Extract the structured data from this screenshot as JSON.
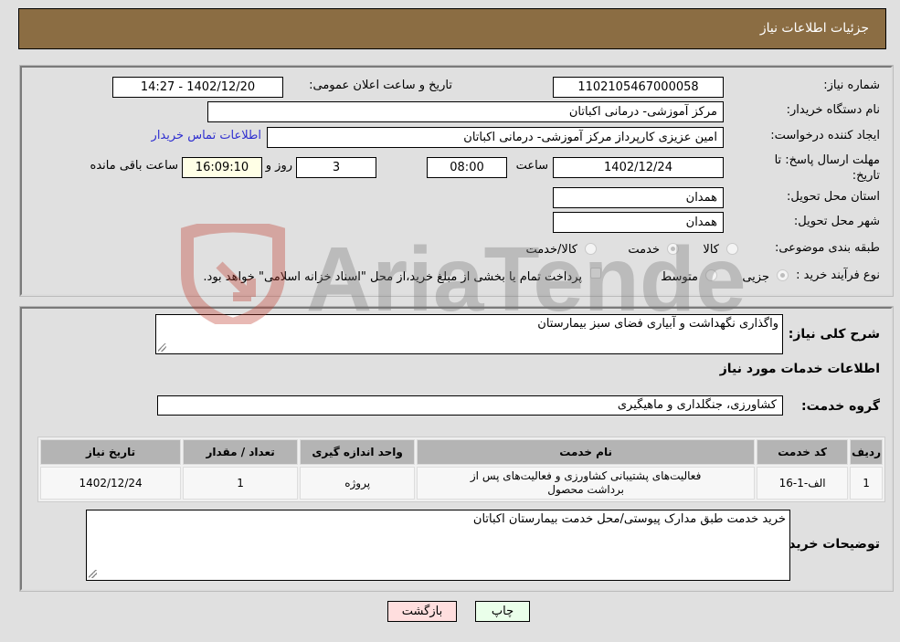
{
  "header": {
    "title": "جزئیات اطلاعات نیاز"
  },
  "form": {
    "need_number": {
      "label": "شماره نیاز:",
      "value": "1102105467000058"
    },
    "announce_datetime": {
      "label": "تاریخ و ساعت اعلان عمومی:",
      "value": "1402/12/20 - 14:27"
    },
    "buyer_org": {
      "label": "نام دستگاه خریدار:",
      "value": "مرکز آموزشی- درمانی اکباتان"
    },
    "requester": {
      "label": "ایجاد کننده درخواست:",
      "value": "امین عزیزی کارپرداز مرکز آموزشی- درمانی اکباتان"
    },
    "buyer_contact_link": "اطلاعات تماس خریدار",
    "deadline": {
      "label": "مهلت ارسال پاسخ: تا تاریخ:",
      "date": "1402/12/24",
      "time_label": "ساعت",
      "time": "08:00",
      "days": "3",
      "days_label": "روز و",
      "remaining": "16:09:10",
      "remaining_label": "ساعت باقی مانده"
    },
    "province": {
      "label": "استان محل تحویل:",
      "value": "همدان"
    },
    "city": {
      "label": "شهر محل تحویل:",
      "value": "همدان"
    },
    "category": {
      "label": "طبقه بندی موضوعی:",
      "options": [
        "کالا",
        "خدمت",
        "کالا/خدمت"
      ],
      "selected": "خدمت"
    },
    "purchase_process": {
      "label": "نوع فرآیند خرید :",
      "options": [
        "جزیی",
        "متوسط"
      ],
      "selected": "جزیی",
      "treasury_note": "پرداخت تمام یا بخشی از مبلغ خرید،از محل \"اسناد خزانه اسلامی\" خواهد بود."
    }
  },
  "details": {
    "description_label": "شرح کلی نیاز:",
    "description": "واگذاری نگهداشت و آبیاری فضای سبز بیمارستان",
    "services_heading": "اطلاعات خدمات مورد نیاز",
    "service_group_label": "گروه خدمت:",
    "service_group": "کشاورزی، جنگلداری و ماهیگیری",
    "table": {
      "headers": [
        "ردیف",
        "کد خدمت",
        "نام خدمت",
        "واحد اندازه گیری",
        "تعداد / مقدار",
        "تاریخ نیاز"
      ],
      "rows": [
        [
          "1",
          "الف-1-16",
          "فعالیت‌های پشتیبانی کشاورزی و فعالیت‌های پس از برداشت محصول",
          "پروژه",
          "1",
          "1402/12/24"
        ]
      ]
    },
    "buyer_notes_label": "توضیحات خریدار:",
    "buyer_notes": "خرید خدمت طبق مدارک پیوستی/محل خدمت بیمارستان اکباتان"
  },
  "buttons": {
    "print": "چاپ",
    "back": "بازگشت"
  },
  "watermark": {
    "text": "AriaTender.neT"
  }
}
